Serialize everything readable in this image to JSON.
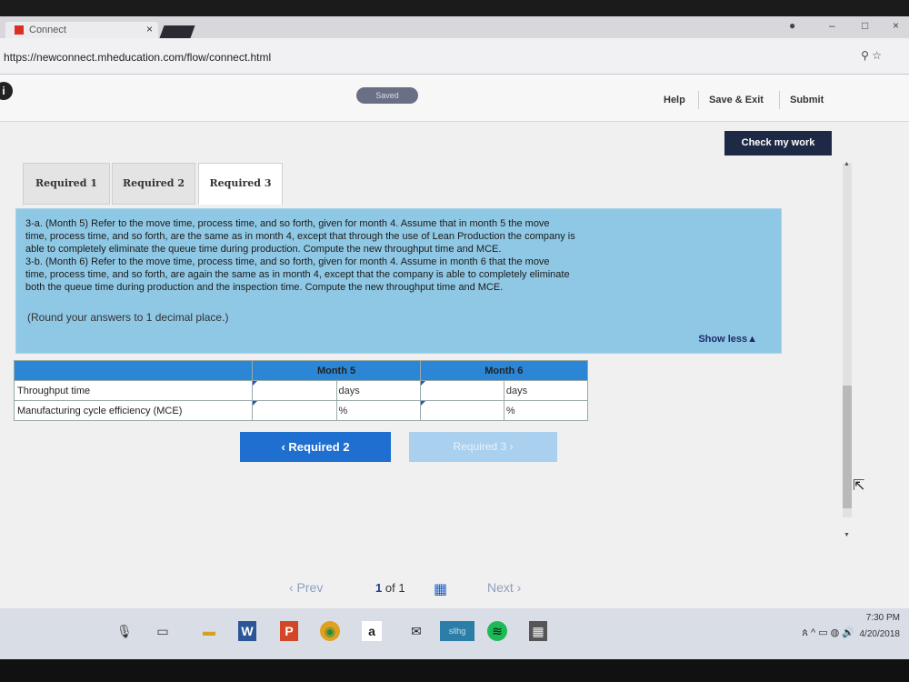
{
  "browser": {
    "tab_title": "Connect",
    "tab_close": "×",
    "url": "https://newconnect.mheducation.com/flow/connect.html",
    "window_controls": [
      "–",
      "□",
      "×"
    ]
  },
  "header": {
    "status": "Saved",
    "help": "Help",
    "save_exit": "Save & Exit",
    "submit": "Submit",
    "info_glyph": "i"
  },
  "main": {
    "check_work": "Check my work",
    "tabs": [
      {
        "label": "Required 1",
        "active": false
      },
      {
        "label": "Required 2",
        "active": false
      },
      {
        "label": "Required 3",
        "active": true
      }
    ],
    "question_lines": [
      "3-a. (Month 5) Refer to the move time, process time, and so forth, given for month 4. Assume that in month 5 the move",
      "time, process time, and so forth, are the same as in month 4, except that through the use of Lean Production the company is",
      "able to completely eliminate the queue time during production.  Compute the new throughput time and MCE.",
      "3-b. (Month 6) Refer to the move time, process time, and so forth, given for month 4. Assume in month 6 that the move",
      "time, process time, and so forth, are again the same as in month 4, except that the company is able to completely eliminate",
      "both the queue time during production and the inspection time. Compute the new throughput time and MCE."
    ],
    "round_note": "(Round your answers to 1 decimal place.)",
    "show_less": "Show less▲",
    "table": {
      "headers": [
        "",
        "Month 5",
        "Month 6"
      ],
      "rows": [
        {
          "label": "Throughput time",
          "m5_value": "",
          "m5_unit": "days",
          "m6_value": "",
          "m6_unit": "days"
        },
        {
          "label": "Manufacturing cycle efficiency (MCE)",
          "m5_value": "",
          "m5_unit": "%",
          "m6_value": "",
          "m6_unit": "%"
        }
      ]
    },
    "nav_prev": "‹  Required 2",
    "nav_next": "Required 3  ›"
  },
  "pager": {
    "prev": "‹  Prev",
    "current": "1",
    "of_text": "of 1",
    "next": "Next  ›"
  },
  "taskbar": {
    "icons": [
      "mic-icon",
      "task-view-icon",
      "file-explorer-icon",
      "word-icon",
      "powerpoint-icon",
      "chrome-icon",
      "amazon-icon",
      "mail-icon",
      "app-icon",
      "spotify-icon",
      "calculator-icon"
    ],
    "app_label": "sllhg",
    "time": "7:30 PM",
    "date": "4/20/2018"
  }
}
